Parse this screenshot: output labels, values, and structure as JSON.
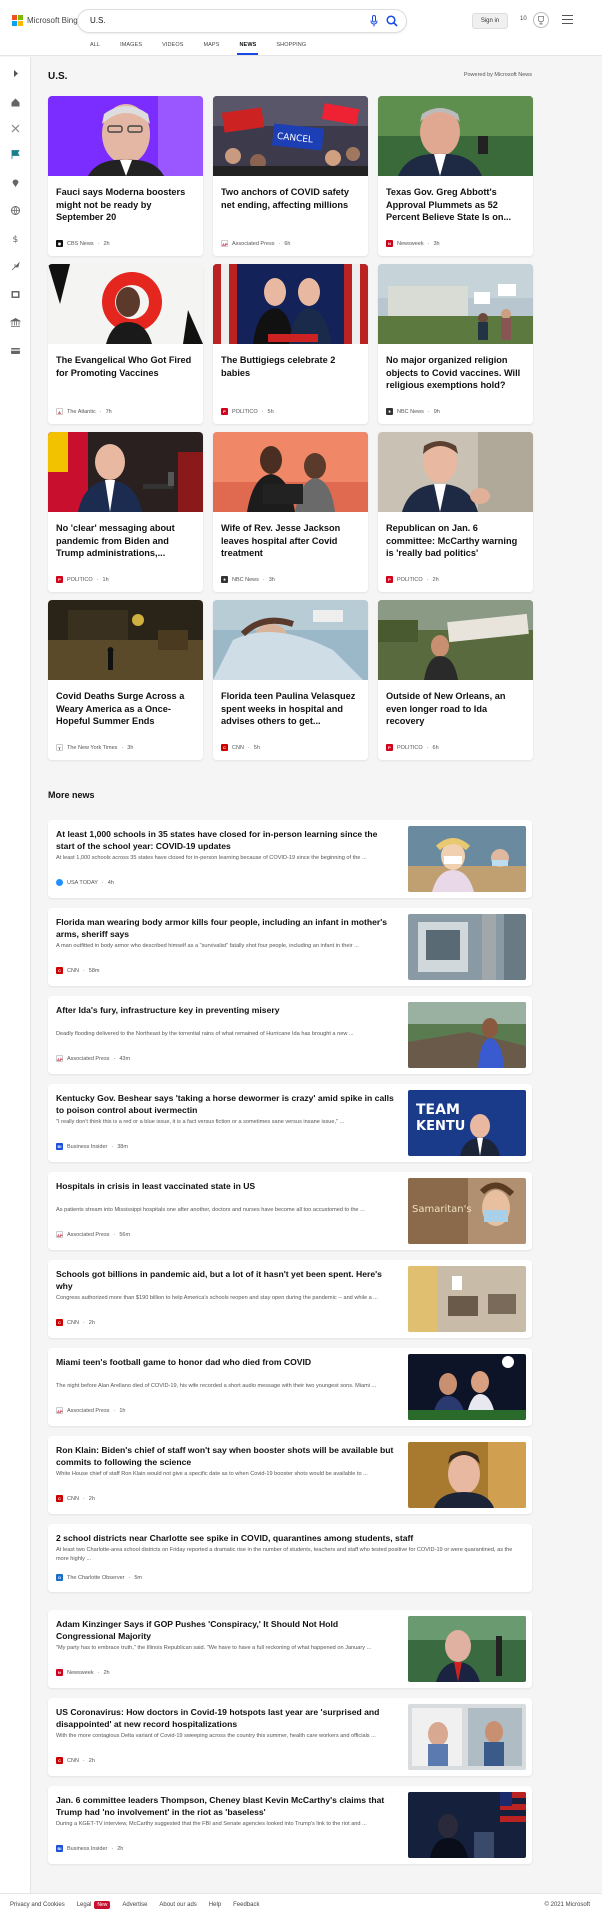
{
  "header": {
    "logo_text": "Microsoft Bing",
    "search_query": "U.S.",
    "signin_label": "Sign in",
    "rewards_count": "10",
    "logo_colors": [
      "#f25022",
      "#7fba00",
      "#00a4ef",
      "#ffb900"
    ],
    "accent": "#174ae4"
  },
  "tabs": [
    {
      "label": "ALL"
    },
    {
      "label": "IMAGES"
    },
    {
      "label": "VIDEOS"
    },
    {
      "label": "MAPS"
    },
    {
      "label": "NEWS",
      "active": true
    },
    {
      "label": "SHOPPING"
    }
  ],
  "section": {
    "title": "U.S.",
    "powered_by": "Powered by Microsoft News"
  },
  "cards": [
    {
      "title": "Fauci says Moderna boosters might not be ready by September 20",
      "source": "CBS News",
      "time": "2h",
      "icon": "cbs-icon"
    },
    {
      "title": "Two anchors of COVID safety net ending, affecting millions",
      "source": "Associated Press",
      "time": "6h",
      "icon": "ap-icon"
    },
    {
      "title": "Texas Gov. Greg Abbott's Approval Plummets as 52 Percent Believe State Is on...",
      "source": "Newsweek",
      "time": "3h",
      "icon": "newsweek-icon"
    },
    {
      "title": "The Evangelical Who Got Fired for Promoting Vaccines",
      "source": "The Atlantic",
      "time": "7h",
      "icon": "atlantic-icon"
    },
    {
      "title": "The Buttigiegs celebrate 2 babies",
      "source": "POLITICO",
      "time": "5h",
      "icon": "politico-icon"
    },
    {
      "title": "No major organized religion objects to Covid vaccines. Will religious exemptions hold?",
      "source": "NBC News",
      "time": "9h",
      "icon": "nbc-icon"
    },
    {
      "title": "No 'clear' messaging about pandemic from Biden and Trump administrations,...",
      "source": "POLITICO",
      "time": "1h",
      "icon": "politico-icon"
    },
    {
      "title": "Wife of Rev. Jesse Jackson leaves hospital after Covid treatment",
      "source": "NBC News",
      "time": "3h",
      "icon": "nbc-icon"
    },
    {
      "title": "Republican on Jan. 6 committee: McCarthy warning is 'really bad politics'",
      "source": "POLITICO",
      "time": "2h",
      "icon": "politico-icon"
    },
    {
      "title": "Covid Deaths Surge Across a Weary America as a Once-Hopeful Summer Ends",
      "source": "The New York Times",
      "time": "3h",
      "icon": "nyt-icon"
    },
    {
      "title": "Florida teen Paulina Velasquez spent weeks in hospital and advises others to get...",
      "source": "CNN",
      "time": "5h",
      "icon": "cnn-icon"
    },
    {
      "title": "Outside of New Orleans, an even longer road to Ida recovery",
      "source": "POLITICO",
      "time": "6h",
      "icon": "politico-icon"
    }
  ],
  "more_news_title": "More news",
  "more_news": [
    {
      "title": "At least 1,000 schools in 35 states have closed for in-person learning since the start of the school year: COVID-19 updates",
      "snippet": "At least 1,000 schools across 35 states have closed for in-person learning because of COVID-19 since the beginning of the ...",
      "source": "USA TODAY",
      "time": "4h",
      "icon": "usatoday-icon"
    },
    {
      "title": "Florida man wearing body armor kills four people, including an infant in mother's arms, sheriff says",
      "snippet": "A man outfitted in body armor who described himself as a \"survivalist\" fatally shot four people, including an infant in their ...",
      "source": "CNN",
      "time": "58m",
      "icon": "cnn-icon"
    },
    {
      "title": "After Ida's fury, infrastructure key in preventing misery",
      "snippet": "Deadly flooding delivered to the Northeast by the torrential rains of what remained of Hurricane Ida has brought a new ...",
      "source": "Associated Press",
      "time": "43m",
      "icon": "ap-icon"
    },
    {
      "title": "Kentucky Gov. Beshear says 'taking a horse dewormer is crazy' amid spike in calls to poison control about ivermectin",
      "snippet": "\"I really don't think this is a red or a blue issue, it is a fact versus fiction or a sometimes sane versus insane issue,\" ...",
      "source": "Business Insider",
      "time": "38m",
      "icon": "businessinsider-icon"
    },
    {
      "title": "Hospitals in crisis in least vaccinated state in US",
      "snippet": "As patients stream into Mississippi hospitals one after another, doctors and nurses have become all too accustomed to the ...",
      "source": "Associated Press",
      "time": "56m",
      "icon": "ap-icon"
    },
    {
      "title": "Schools got billions in pandemic aid, but a lot of it hasn't yet been spent. Here's why",
      "snippet": "Congress authorized more than $190 billion to help America's schools reopen and stay open during the pandemic -- and while a ...",
      "source": "CNN",
      "time": "2h",
      "icon": "cnn-icon"
    },
    {
      "title": "Miami teen's football game to honor dad who died from COVID",
      "snippet": "The night before Alan Arellano died of COVID-19, his wife recorded a short audio message with their two youngest sons. Miami ...",
      "source": "Associated Press",
      "time": "1h",
      "icon": "ap-icon"
    },
    {
      "title": "Ron Klain: Biden's chief of staff won't say when booster shots will be available but commits to following the science",
      "snippet": "White House chief of staff Ron Klain would not give a specific date as to when Covid-19 booster shots would be available to ...",
      "source": "CNN",
      "time": "2h",
      "icon": "cnn-icon"
    },
    {
      "title": "2 school districts near Charlotte see spike in COVID, quarantines among students, staff",
      "snippet": "At least two Charlotte-area school districts on Friday reported a dramatic rise in the number of students, teachers and staff who tested positive for COVID-19 or were quarantined, as the more highly ...",
      "source": "The Charlotte Observer",
      "time": "5m",
      "icon": "charlotte-observer-icon"
    },
    {
      "title": "Adam Kinzinger Says if GOP Pushes 'Conspiracy,' It Should Not Hold Congressional Majority",
      "snippet": "\"My party has to embrace truth,\" the Illinois Republican said. \"We have to have a full reckoning of what happened on January ...",
      "source": "Newsweek",
      "time": "2h",
      "icon": "newsweek-icon"
    },
    {
      "title": "US Coronavirus: How doctors in Covid-19 hotspots last year are 'surprised and disappointed' at new record hospitalizations",
      "snippet": "With the more contagious Delta variant of Covid-19 sweeping across the country this summer, health care workers and officials ...",
      "source": "CNN",
      "time": "2h",
      "icon": "cnn-icon"
    },
    {
      "title": "Jan. 6 committee leaders Thompson, Cheney blast Kevin McCarthy's claims that Trump had 'no involvement' in the riot as 'baseless'",
      "snippet": "During a KGET-TV interview, McCarthy suggested that the FBI and Senate agencies looked into Trump's link to the riot and ...",
      "source": "Business Insider",
      "time": "2h",
      "icon": "businessinsider-icon"
    }
  ],
  "footer": {
    "links": [
      "Privacy and Cookies",
      "Legal",
      "Advertise",
      "About our ads",
      "Help",
      "Feedback"
    ],
    "new_badge": "New",
    "copyright": "© 2021 Microsoft"
  }
}
